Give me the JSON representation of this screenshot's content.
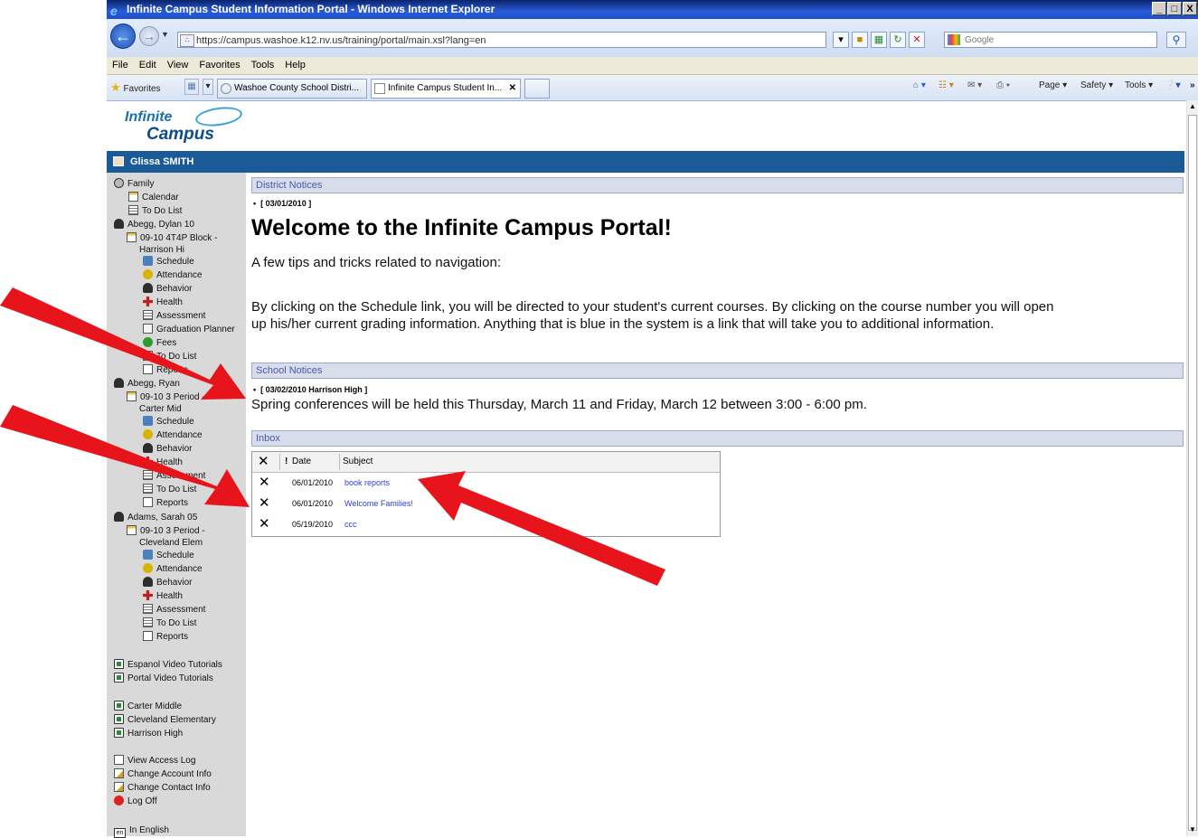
{
  "window": {
    "title": "Infinite Campus Student Information Portal - Windows Internet Explorer",
    "buttons": [
      "_",
      "□",
      "X"
    ]
  },
  "address_bar": {
    "url": "https://campus.washoe.k12.nv.us/training/portal/main.xsl?lang=en",
    "search_placeholder": "Google"
  },
  "menu": [
    "File",
    "Edit",
    "View",
    "Favorites",
    "Tools",
    "Help"
  ],
  "tabs": {
    "favorites": "Favorites",
    "items": [
      "Washoe County School Distri...",
      "Infinite Campus Student In..."
    ],
    "close": "✕"
  },
  "command_bar": [
    "Page ▾",
    "Safety ▾",
    "Tools ▾"
  ],
  "logo": {
    "line1": "Infinite",
    "line2": "Campus"
  },
  "user": {
    "name": "Glissa SMITH"
  },
  "sidebar": {
    "family": {
      "label": "Family",
      "items": [
        "Calendar",
        "To Do List"
      ]
    },
    "students": [
      {
        "name": "Abegg, Dylan 10",
        "schedule_line1": "09-10 4T4P Block -",
        "schedule_line2": "Harrison Hi",
        "items": [
          "Schedule",
          "Attendance",
          "Behavior",
          "Health",
          "Assessment",
          "Graduation Planner",
          "Fees",
          "To Do List",
          "Reports"
        ]
      },
      {
        "name": "Abegg, Ryan",
        "schedule_line1": "09-10 3 Period -",
        "schedule_line2": "Carter Mid",
        "items": [
          "Schedule",
          "Attendance",
          "Behavior",
          "Health",
          "Assessment",
          "To Do List",
          "Reports"
        ]
      },
      {
        "name": "Adams, Sarah 05",
        "schedule_line1": "09-10 3 Period -",
        "schedule_line2": "Cleveland Elem",
        "items": [
          "Schedule",
          "Attendance",
          "Behavior",
          "Health",
          "Assessment",
          "To Do List",
          "Reports"
        ]
      }
    ],
    "tutorials": [
      "Espanol Video Tutorials",
      "Portal Video Tutorials"
    ],
    "schools": [
      "Carter Middle",
      "Cleveland Elementary",
      "Harrison High"
    ],
    "account": [
      "View Access Log",
      "Change Account Info",
      "Change Contact Info",
      "Log Off"
    ],
    "language": {
      "code": "en",
      "label": "In English"
    }
  },
  "district_notices": {
    "header": "District Notices",
    "date": "[ 03/01/2010 ]",
    "title": "Welcome to the Infinite Campus Portal!",
    "intro": "A few tips and tricks related to navigation:",
    "body_line1": "By clicking on the Schedule link, you will be directed to your student's current courses.  By clicking on the course number you will open",
    "body_line2": "up his/her current grading information.  Anything that is blue in the system is a link that will take you to additional information."
  },
  "school_notices": {
    "header": "School Notices",
    "date": "[ 03/02/2010 Harrison High ]",
    "text": "Spring conferences will be held this Thursday, March 11 and Friday, March 12 between 3:00 - 6:00 pm."
  },
  "inbox": {
    "header": "Inbox",
    "columns": [
      "✕",
      "!",
      "Date",
      "Subject"
    ],
    "rows": [
      {
        "delete": "✕",
        "date": "06/01/2010",
        "subject": "book reports"
      },
      {
        "delete": "✕",
        "date": "06/01/2010",
        "subject": "Welcome Families!"
      },
      {
        "delete": "✕",
        "date": "05/19/2010",
        "subject": "ccc"
      }
    ]
  },
  "colors": {
    "header_bar": "#1a5a96",
    "arrow": "#e8141c",
    "link": "#2a3fd0",
    "section_header": "#d8ddec"
  }
}
